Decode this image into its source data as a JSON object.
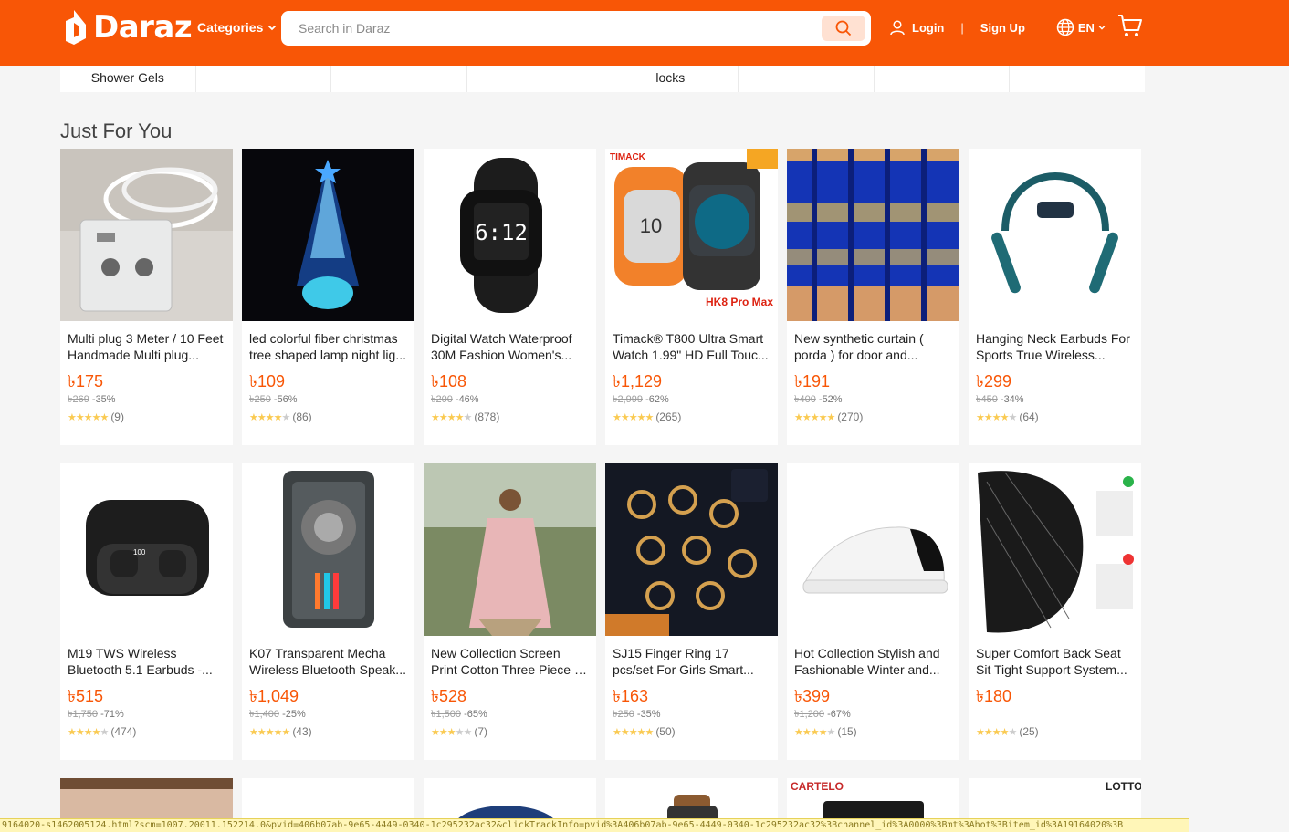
{
  "header": {
    "logo_text": "Daraz",
    "categories_label": "Categories",
    "search_placeholder": "Search in Daraz",
    "login_label": "Login",
    "separator": "|",
    "signup_label": "Sign Up",
    "lang_label": "EN",
    "brand_color": "#f85606"
  },
  "category_strip": [
    "Shower Gels",
    "",
    "",
    "",
    "locks",
    "",
    "",
    ""
  ],
  "section_title": "Just For You",
  "products": [
    {
      "title": "Multi plug 3 Meter / 10 Feet Handmade Multi plug...",
      "price": "৳175",
      "old_price": "৳269",
      "discount": "-35%",
      "rating": 5,
      "reviews": "(9)",
      "img": "plug"
    },
    {
      "title": "led colorful fiber christmas tree shaped lamp night lig...",
      "price": "৳109",
      "old_price": "৳250",
      "discount": "-56%",
      "rating": 4,
      "reviews": "(86)",
      "img": "tree"
    },
    {
      "title": "Digital Watch Waterproof 30M Fashion Women's...",
      "price": "৳108",
      "old_price": "৳200",
      "discount": "-46%",
      "rating": 4,
      "reviews": "(878)",
      "img": "watch"
    },
    {
      "title": "Timack® T800 Ultra Smart Watch 1.99\" HD Full Touc...",
      "price": "৳1,129",
      "old_price": "৳2,999",
      "discount": "-62%",
      "rating": 5,
      "reviews": "(265)",
      "img": "smartwatch"
    },
    {
      "title": "New synthetic curtain ( porda ) for door and...",
      "price": "৳191",
      "old_price": "৳400",
      "discount": "-52%",
      "rating": 4.5,
      "reviews": "(270)",
      "img": "curtain"
    },
    {
      "title": "Hanging Neck Earbuds For Sports True Wireless...",
      "price": "৳299",
      "old_price": "৳450",
      "discount": "-34%",
      "rating": 4,
      "reviews": "(64)",
      "img": "neckband"
    },
    {
      "title": "M19 TWS Wireless Bluetooth 5.1 Earbuds -...",
      "price": "৳515",
      "old_price": "৳1,750",
      "discount": "-71%",
      "rating": 4,
      "reviews": "(474)",
      "img": "earbuds"
    },
    {
      "title": "K07 Transparent Mecha Wireless Bluetooth Speak...",
      "price": "৳1,049",
      "old_price": "৳1,400",
      "discount": "-25%",
      "rating": 4.5,
      "reviews": "(43)",
      "img": "speaker"
    },
    {
      "title": "New Collection Screen Print Cotton Three Piece - 3 Pic...",
      "price": "৳528",
      "old_price": "৳1,500",
      "discount": "-65%",
      "rating": 3,
      "reviews": "(7)",
      "img": "dress"
    },
    {
      "title": "SJ15 Finger Ring 17 pcs/set For Girls Smart...",
      "price": "৳163",
      "old_price": "৳250",
      "discount": "-35%",
      "rating": 5,
      "reviews": "(50)",
      "img": "rings"
    },
    {
      "title": "Hot Collection Stylish and Fashionable Winter and...",
      "price": "৳399",
      "old_price": "৳1,200",
      "discount": "-67%",
      "rating": 4,
      "reviews": "(15)",
      "img": "shoe"
    },
    {
      "title": "Super Comfort Back Seat Sit Tight Support System...",
      "price": "৳180",
      "old_price": "",
      "discount": "",
      "rating": 4,
      "reviews": "(25)",
      "img": "backrest"
    }
  ],
  "partial_row": [
    {
      "img": "hand"
    },
    {
      "img": "blank"
    },
    {
      "img": "cap"
    },
    {
      "img": "strap"
    },
    {
      "img": "wallet",
      "brand": "CARTELO"
    },
    {
      "img": "lotto",
      "brand": "LOTTO"
    }
  ],
  "status_url": "9164020-s1462005124.html?scm=1007.20011.152214.0&pvid=406b07ab-9e65-4449-0340-1c295232ac32&clickTrackInfo=pvid%3A406b07ab-9e65-4449-0340-1c295232ac32%3Bchannel_id%3A0000%3Bmt%3Ahot%3Bitem_id%3A19164020%3B"
}
